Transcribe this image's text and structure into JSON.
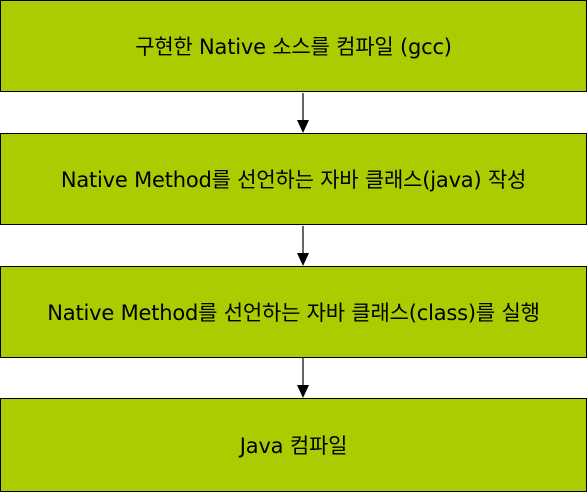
{
  "steps": [
    {
      "label": "구현한 Native 소스를 컴파일 (gcc)"
    },
    {
      "label": "Native Method를 선언하는 자바 클래스(java) 작성"
    },
    {
      "label": "Native Method를 선언하는 자바 클래스(class)를 실행"
    },
    {
      "label": "Java 컴파일"
    }
  ],
  "colors": {
    "box_fill": "#aacc00",
    "border": "#000000",
    "arrow": "#000000"
  }
}
